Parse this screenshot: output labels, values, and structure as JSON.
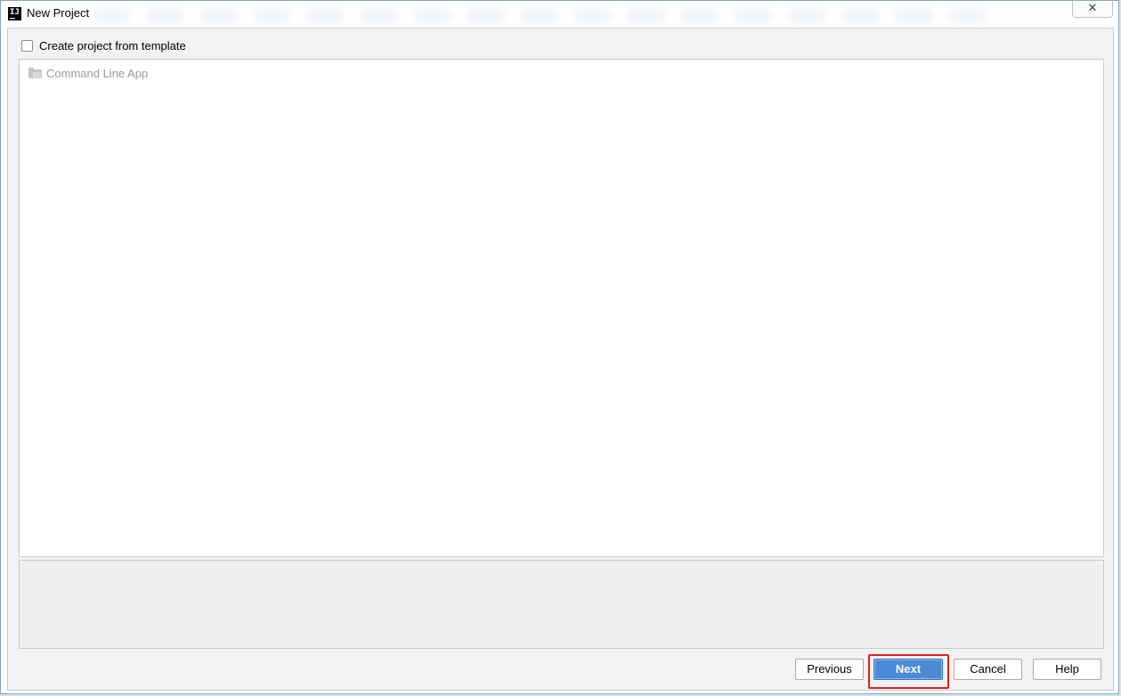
{
  "window": {
    "title": "New Project",
    "close_glyph": "✕",
    "app_icon": "intellij-idea-icon",
    "app_icon_text": "IJ"
  },
  "template_option": {
    "label": "Create project from template",
    "checked": false
  },
  "template_list": {
    "items": [
      {
        "label": "Command Line App",
        "icon": "folder-icon",
        "enabled": false
      }
    ]
  },
  "buttons": {
    "previous": "Previous",
    "next": "Next",
    "cancel": "Cancel",
    "help": "Help"
  },
  "colors": {
    "primary_button": "#4b8ad6",
    "highlight": "#e0201c",
    "disabled_text": "#9a9a9a"
  }
}
